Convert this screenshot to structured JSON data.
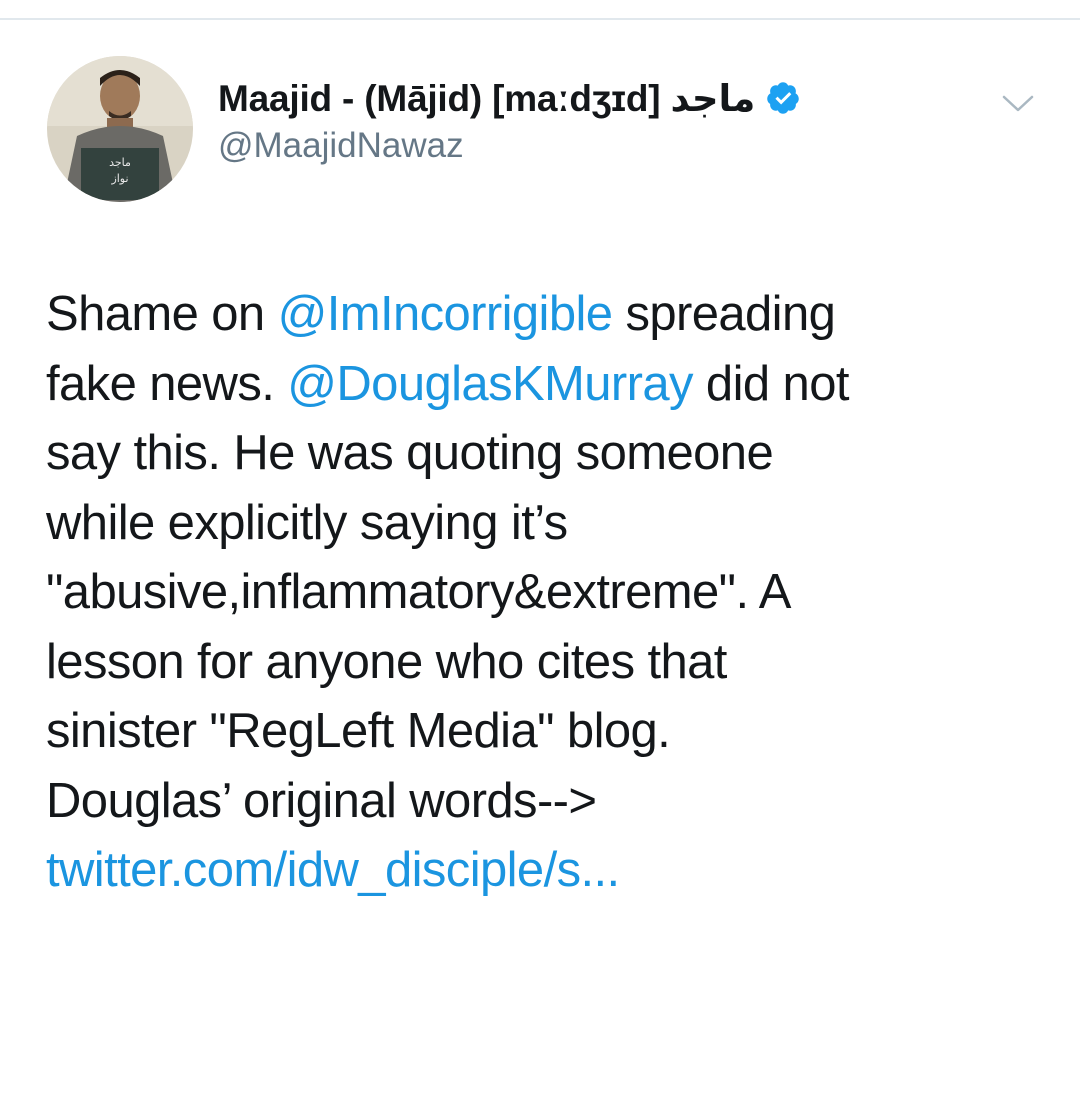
{
  "tweet": {
    "author": {
      "display_name": "Maajid - (Mājid) [maːdʒɪd] ماجد",
      "handle": "@MaajidNawaz",
      "verified": true,
      "verified_icon": "verified-badge-icon",
      "avatar_icon": "avatar-photo"
    },
    "menu_icon": "chevron-down-icon",
    "body": {
      "line1": {
        "pre": "Shame on ",
        "mention": "@ImIncorrigible",
        "post": " spreading"
      },
      "line2": {
        "pre": "fake news. ",
        "mention": "@DouglasKMurray",
        "post": " did not"
      },
      "line3": "say this. He was quoting someone",
      "line4": "while explicitly saying it’s",
      "line5": "\"abusive,inflammatory&extreme\". A",
      "line6": "lesson for anyone who cites that",
      "line7": "sinister \"RegLeft Media\" blog.",
      "line8": "Douglas’ original words-->",
      "link": "twitter.com/idw_disciple/s..."
    }
  },
  "colors": {
    "link": "#1b95e0",
    "verified": "#1da1f2",
    "text": "#14171a",
    "secondary_text": "#657786",
    "divider": "#e1e8ed"
  }
}
